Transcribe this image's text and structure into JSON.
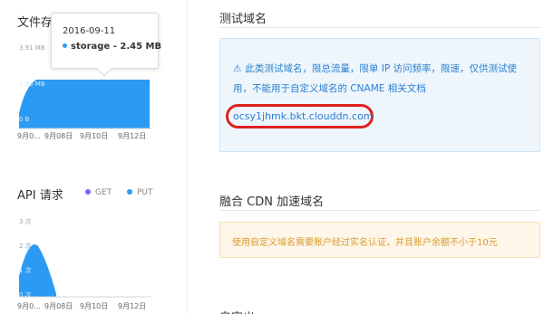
{
  "storage_panel": {
    "title": "文件存储",
    "y_ticks": [
      "3.91 MB",
      "1.95 MB",
      "0 B"
    ],
    "x_ticks": [
      "9月0...",
      "9月08日",
      "9月10日",
      "9月12日"
    ],
    "tooltip": {
      "date": "2016-09-11",
      "series_label": "storage",
      "separator": " - ",
      "value": "2.45 MB"
    },
    "series_color": "#2b9af3"
  },
  "api_panel": {
    "title": "API 请求",
    "legend": [
      {
        "label": "GET",
        "color": "#7b61ff"
      },
      {
        "label": "PUT",
        "color": "#2b9af3"
      }
    ],
    "y_ticks": [
      "3 次",
      "2 次",
      "1 次",
      "0 次"
    ],
    "x_ticks": [
      "9月0...",
      "9月08日",
      "9月10日",
      "9月12日"
    ]
  },
  "test_domain": {
    "section_title": "测试域名",
    "warning_icon": "⚠",
    "notice": "此类测试域名，限总流量，限单 IP 访问频率，限速，仅供测试使用，不能用于自定义域名的 CNAME 相关文档",
    "domain": "ocsy1jhmk.bkt.clouddn.com"
  },
  "cdn": {
    "section_title": "融合 CDN 加速域名",
    "warning": "使用自定义域名需要账户经过实名认证，并且账户余额不小于10元"
  },
  "next_section": {
    "title": "自定义"
  },
  "colors": {
    "accent": "#2b9af3",
    "link": "#2a7fcf",
    "highlight_circle": "#e0211e",
    "warning_text": "#d99a2b"
  }
}
